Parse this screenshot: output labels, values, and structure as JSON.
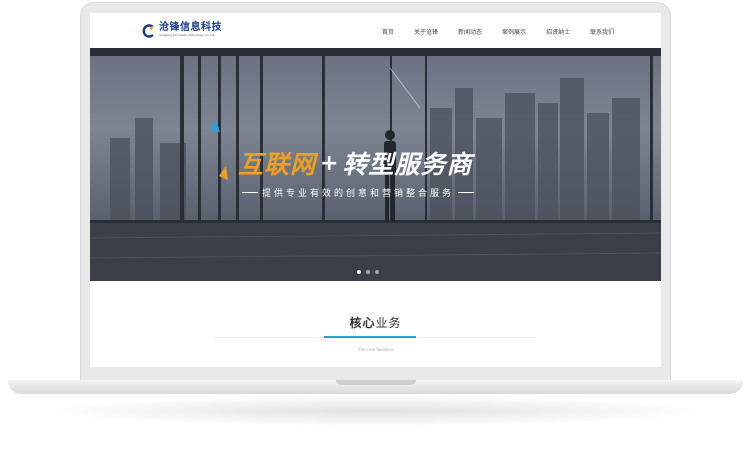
{
  "header": {
    "logo_name": "沧锋信息科技",
    "logo_sub": "Cangfeng Information Technology Co.,Ltd.",
    "nav": [
      "首页",
      "关于沧锋",
      "新闻动态",
      "案例展示",
      "招贤纳士",
      "联系我们"
    ]
  },
  "banner": {
    "slogan_a": "互联网",
    "slogan_plus": "+",
    "slogan_b": "转型服务商",
    "subtitle": "提供专业有效的创意和营销整合服务",
    "slide_count": 3,
    "active_slide": 1
  },
  "section": {
    "title_bold": "核心",
    "title_rest": "业务",
    "subtitle": "The core business"
  },
  "colors": {
    "accent_blue": "#29a0d8",
    "slogan_orange": "#f0a020",
    "logo_blue": "#1a3c8c"
  }
}
